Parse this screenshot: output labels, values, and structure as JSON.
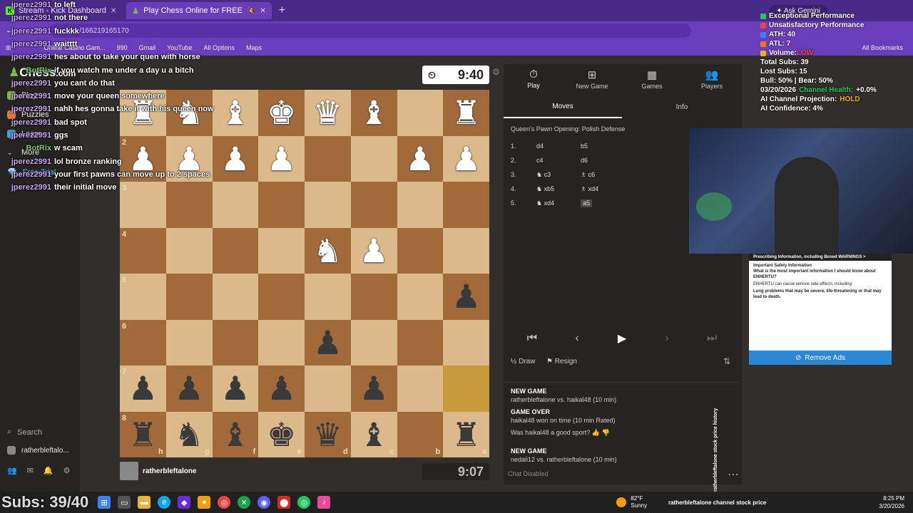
{
  "browser": {
    "tabs": [
      {
        "label": "Stream - Kick Dashboard",
        "active": false
      },
      {
        "label": "Play Chess Online for FREE",
        "active": true
      }
    ],
    "url": "/166219165170",
    "bookmarks": [
      "Online Casino Gam...",
      "990",
      "Gmail",
      "YouTube",
      "All Options",
      "Maps"
    ],
    "all_bookmarks": "All Bookmarks",
    "ask_gemini": "Ask Gemini"
  },
  "sidebar": {
    "logo_main": "Chess",
    "logo_suffix": ".com",
    "items": [
      {
        "label": "Play",
        "color": "#81b64c"
      },
      {
        "label": "Puzzles",
        "color": "#e8743b"
      },
      {
        "label": "Learn",
        "color": "#3d9fd6"
      },
      {
        "label": "More",
        "color": "#999999"
      },
      {
        "label": "Free Trial",
        "color": "#4fc3f7"
      }
    ],
    "search": "Search",
    "username": "ratherbleftalo..."
  },
  "game": {
    "top_clock": "9:40",
    "bottom_clock": "9:07",
    "bottom_player": "ratherbleftalone",
    "board": [
      [
        "wR",
        "wN",
        "wB",
        "wK",
        "wQ",
        "wB",
        "",
        "wR"
      ],
      [
        "wP",
        "wP",
        "wP",
        "wP",
        "",
        "",
        "wP",
        "wP"
      ],
      [
        "",
        "",
        "",
        "",
        "",
        "",
        "",
        ""
      ],
      [
        "",
        "",
        "",
        "",
        "wN",
        "wP",
        "",
        ""
      ],
      [
        "",
        "",
        "",
        "",
        "",
        "",
        "",
        "bP"
      ],
      [
        "",
        "",
        "",
        "",
        "bP",
        "",
        "",
        ""
      ],
      [
        "bP",
        "bP",
        "bP",
        "bP",
        "",
        "bP",
        "",
        ""
      ],
      [
        "bR",
        "bN",
        "bB",
        "bK",
        "bQ",
        "bB",
        "",
        "bR"
      ]
    ],
    "ranks": [
      "1",
      "2",
      "3",
      "4",
      "5",
      "6",
      "7",
      "8"
    ],
    "files": [
      "h",
      "g",
      "f",
      "e",
      "d",
      "c",
      "b",
      "a"
    ]
  },
  "panel": {
    "tabs": [
      {
        "label": "Play",
        "icon": "stopwatch-icon"
      },
      {
        "label": "New Game",
        "icon": "plus-icon"
      },
      {
        "label": "Games",
        "icon": "grid-icon"
      },
      {
        "label": "Players",
        "icon": "players-icon"
      }
    ],
    "subtabs": [
      "Moves",
      "Info"
    ],
    "opening": "Queen's Pawn Opening: Polish Defense",
    "moves": [
      {
        "n": "1.",
        "w": "d4",
        "b": "b5"
      },
      {
        "n": "2.",
        "w": "c4",
        "b": "d6"
      },
      {
        "n": "3.",
        "w": "♞ c3",
        "b": "♗ c6"
      },
      {
        "n": "4.",
        "w": "♞ xb5",
        "b": "♗ xd4"
      },
      {
        "n": "5.",
        "w": "♞ xd4",
        "b": "a5"
      }
    ],
    "draw": "Draw",
    "resign": "Resign",
    "draw_prefix": "½",
    "feed": [
      {
        "title": "NEW GAME",
        "text": "ratherbleftalone vs. haikal48 (10 min)"
      },
      {
        "title": "GAME OVER",
        "text": "haikal48 won on time (10 min Rated)"
      },
      {
        "title": "",
        "text": "Was haikal48 a good sport?"
      },
      {
        "title": "NEW GAME",
        "text": "nedali12 vs. ratherbleftalone (10 min)"
      }
    ],
    "chat_disabled": "Chat Disabled"
  },
  "chat": [
    {
      "user": "jperez2991",
      "text": "to left",
      "bot": false
    },
    {
      "user": "jperez2991",
      "text": "not there",
      "bot": false
    },
    {
      "user": "jperez2991",
      "text": "fuckkk",
      "bot": false
    },
    {
      "user": "jperez2991",
      "text": "waitttt",
      "bot": false
    },
    {
      "user": "jperez2991",
      "text": "hes about to take your quen with horse",
      "bot": false
    },
    {
      "user": "BotRix",
      "text": "if you watch me under a day u a bitch",
      "bot": true
    },
    {
      "user": "jperez2991",
      "text": "you cant do that",
      "bot": false
    },
    {
      "user": "jperez2991",
      "text": "move your queen somewhere",
      "bot": false
    },
    {
      "user": "jperez2991",
      "text": "nahh hes gonna take it with his queen now",
      "bot": false
    },
    {
      "user": "jperez2991",
      "text": "bad spot",
      "bot": false
    },
    {
      "user": "jperez2991",
      "text": "ggs",
      "bot": false
    },
    {
      "user": "BotRix",
      "text": "w scam",
      "bot": true
    },
    {
      "user": "jperez2991",
      "text": "lol bronze ranking",
      "bot": false
    },
    {
      "user": "jperez2991",
      "text": "your first pawns can move up to 2 spaces",
      "bot": false
    },
    {
      "user": "jperez2991",
      "text": "their initial move",
      "bot": false
    }
  ],
  "stats": {
    "lines": [
      {
        "text": "Exceptional Performance",
        "color": "#22c55e"
      },
      {
        "text": "Unsatisfactory Performance",
        "color": "#ef4444"
      },
      {
        "text": "ATH: 40",
        "color": "#3b82f6"
      },
      {
        "text": "ATL: 7",
        "color": "#f97316"
      },
      {
        "text": "Volume: ",
        "color": "#eab308"
      }
    ],
    "volume_value": "LOW",
    "total_subs": "Total Subs: 39",
    "lost_subs": "Lost Subs: 15",
    "bull_bear": "Bull: 50% | Bear: 50%",
    "date": "03/20/2026",
    "channel_health_label": "Channel Health:",
    "channel_health_value": "+0.0%",
    "projection_label": "AI Channel Projection:",
    "projection_value": "HOLD",
    "confidence": "AI Confidence: 4%"
  },
  "ad": {
    "header": "Prescribing Information, including Boxed WARNINGS >",
    "title": "Important Safety Information",
    "q": "What is the most important information I should know about ENHERTU?",
    "body": "ENHERTU can cause serious side effects, including:",
    "bullet": "Lung problems that may be severe, life-threatening or that may lead to death.",
    "remove": "Remove Ads"
  },
  "overlay": {
    "subs": "Subs: 39/40",
    "vertical": "ratherbleftalone stock price history",
    "footer": "ratherbleftalone channel stock price"
  },
  "taskbar": {
    "weather": "82°F",
    "weather_desc": "Sunny",
    "time": "8:25 PM",
    "date": "3/20/2026"
  },
  "colors": {
    "kick_green": "#53fc18",
    "chess_green": "#81b64c"
  }
}
